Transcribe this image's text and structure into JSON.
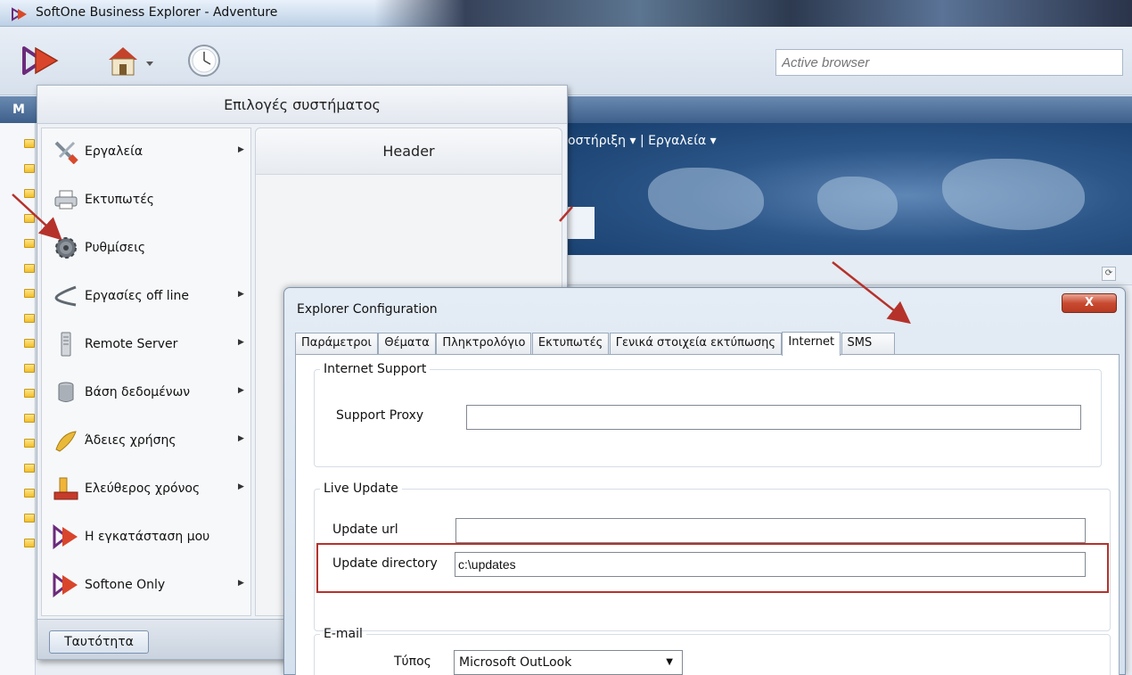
{
  "window": {
    "title": "SoftOne Business Explorer - Adventure"
  },
  "toolbar": {
    "active_browser_placeholder": "Active browser"
  },
  "background": {
    "strip_letter": "M",
    "menu_text": "οστήριξη ▾ | Εργαλεία ▾"
  },
  "system_menu": {
    "title": "Επιλογές συστήματος",
    "items": [
      {
        "label": "Εργαλεία",
        "icon": "tools-icon",
        "has_submenu": true
      },
      {
        "label": "Εκτυπωτές",
        "icon": "printer-icon",
        "has_submenu": false
      },
      {
        "label": "Ρυθμίσεις",
        "icon": "gear-icon",
        "has_submenu": false
      },
      {
        "label": "Εργασίες off line",
        "icon": "offline-icon",
        "has_submenu": true
      },
      {
        "label": "Remote Server",
        "icon": "server-icon",
        "has_submenu": true
      },
      {
        "label": "Βάση δεδομένων",
        "icon": "database-icon",
        "has_submenu": true
      },
      {
        "label": "Άδειες χρήσης",
        "icon": "license-icon",
        "has_submenu": true
      },
      {
        "label": "Ελεύθερος χρόνος",
        "icon": "freetime-icon",
        "has_submenu": true
      },
      {
        "label": "Η εγκατάσταση μου",
        "icon": "softone-logo-icon",
        "has_submenu": false
      },
      {
        "label": "Softone Only",
        "icon": "softone-logo-icon",
        "has_submenu": true
      }
    ],
    "submenu_header": "Header",
    "identity_button": "Ταυτότητα"
  },
  "dialog": {
    "title": "Explorer Configuration",
    "close_label": "X",
    "tabs": [
      {
        "label": "Παράμετροι",
        "active": false
      },
      {
        "label": "Θέματα",
        "active": false
      },
      {
        "label": "Πληκτρολόγιο",
        "active": false
      },
      {
        "label": "Εκτυπωτές",
        "active": false
      },
      {
        "label": "Γενικά στοιχεία εκτύπωσης",
        "active": false
      },
      {
        "label": "Internet",
        "active": true
      },
      {
        "label": "SMS",
        "active": false
      }
    ],
    "internet_support": {
      "legend": "Internet Support",
      "support_proxy_label": "Support Proxy",
      "support_proxy_value": ""
    },
    "live_update": {
      "legend": "Live Update",
      "update_url_label": "Update url",
      "update_url_value": "",
      "update_directory_label": "Update directory",
      "update_directory_value": "c:\\updates"
    },
    "email": {
      "legend": "E-mail",
      "type_label": "Τύπος",
      "type_value": "Microsoft OutLook"
    }
  },
  "colors": {
    "annotation_red": "#b5322b",
    "dialog_border": "#7f94ad",
    "close_button": "#c84b31"
  }
}
